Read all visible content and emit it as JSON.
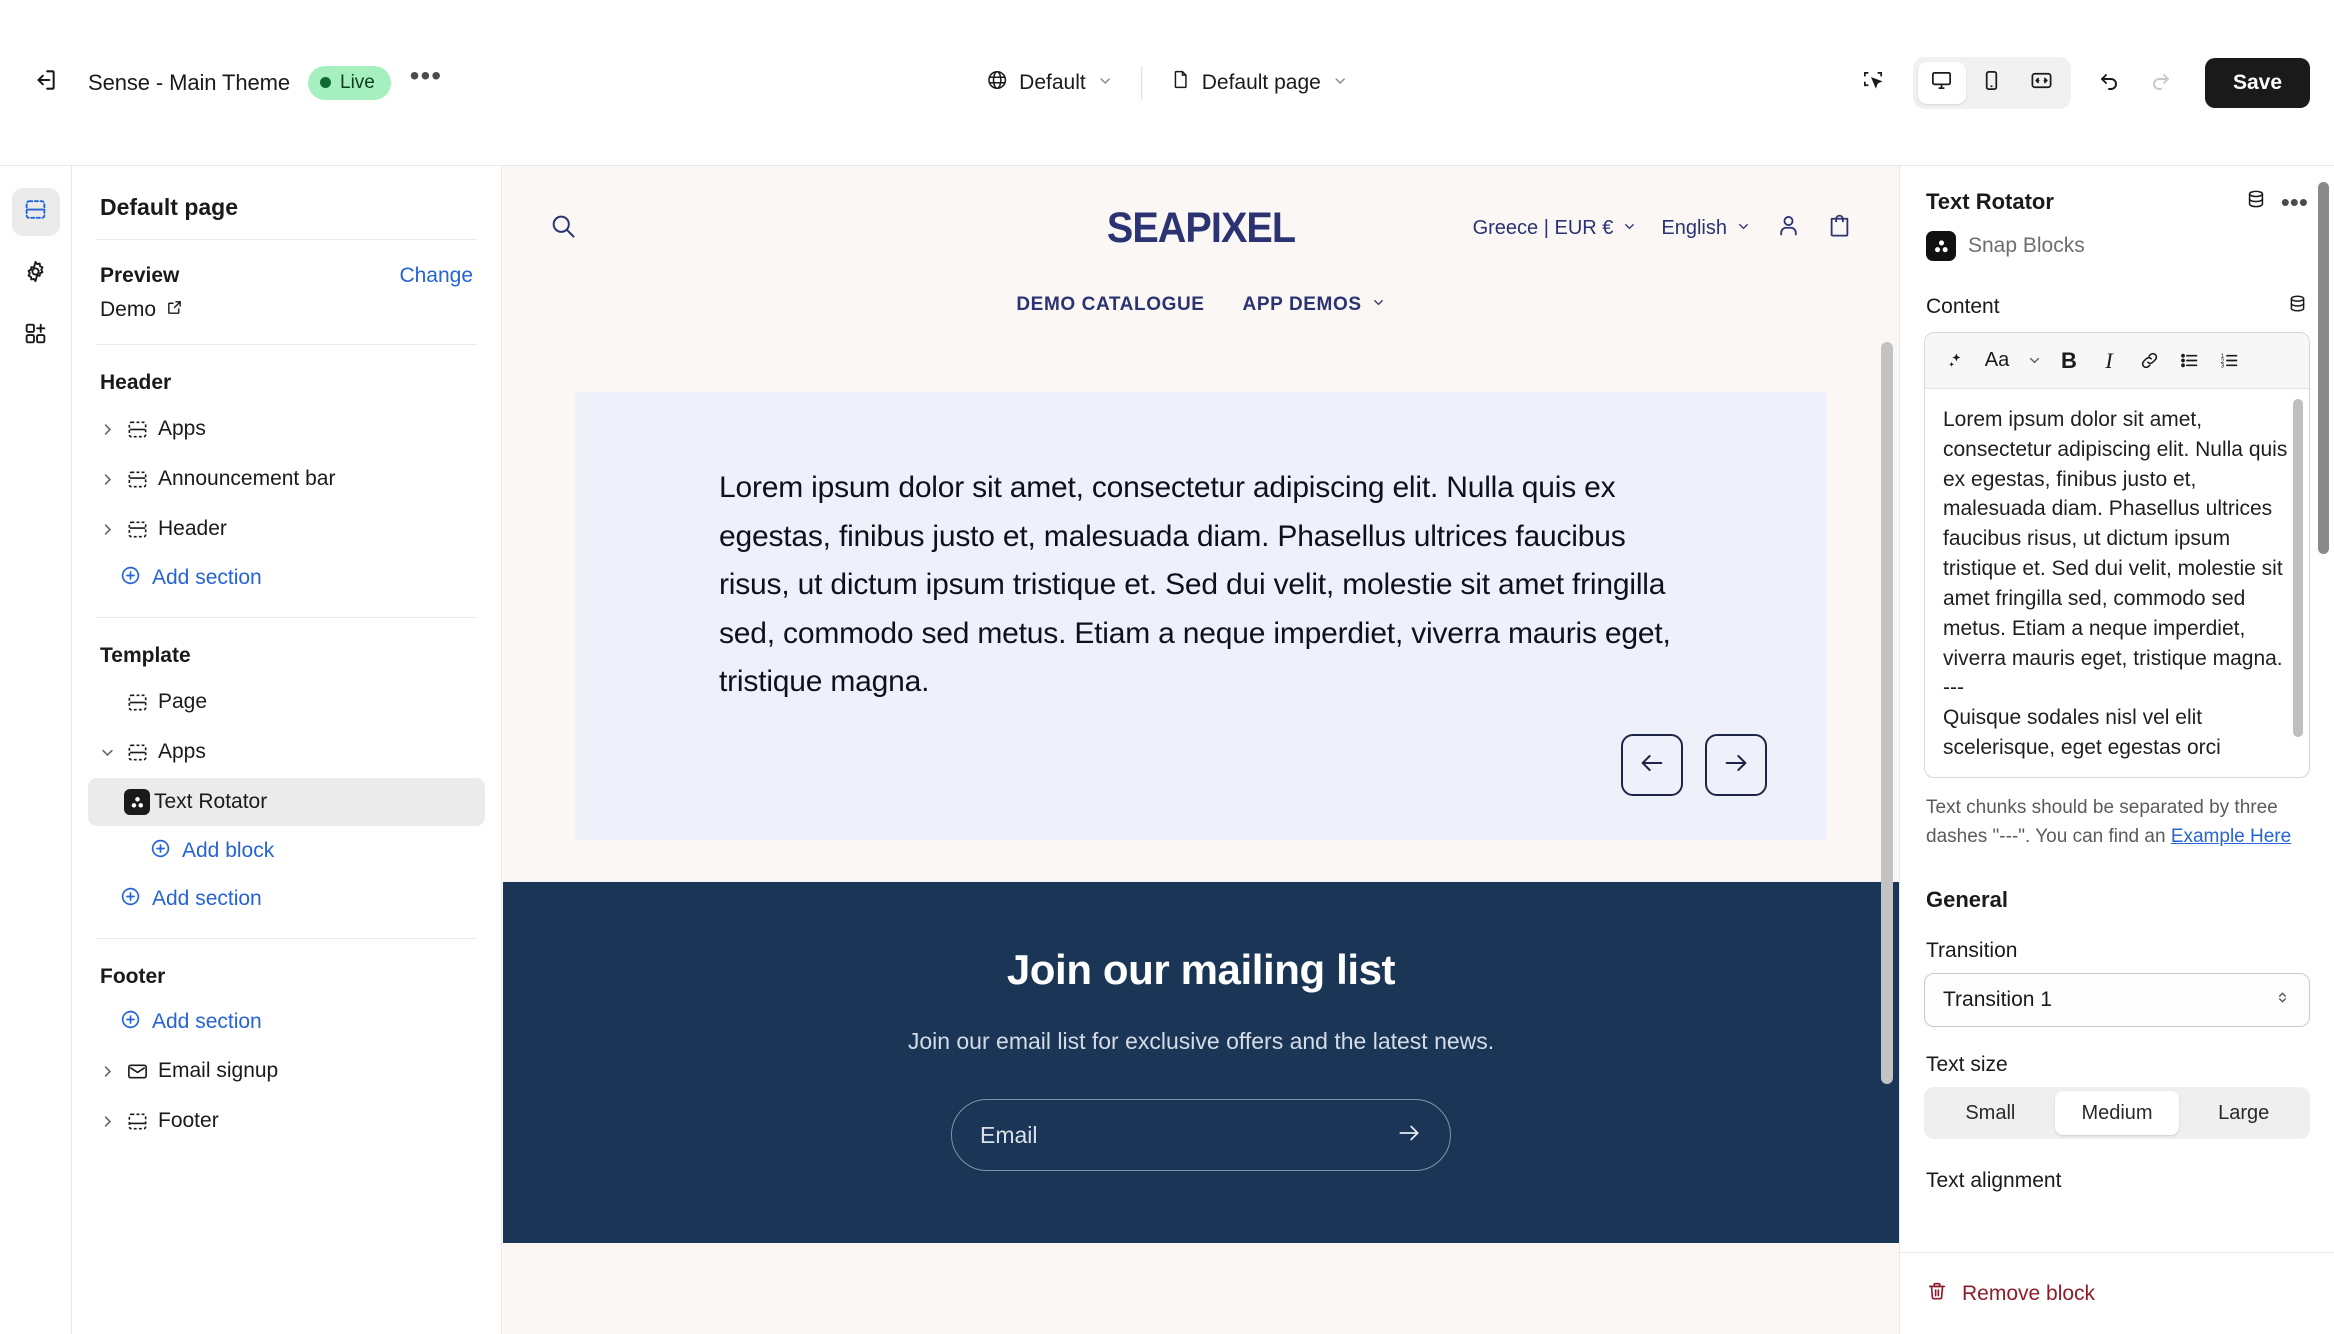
{
  "topbar": {
    "exit_icon": "exit-icon",
    "theme_name": "Sense - Main Theme",
    "status_badge": "Live",
    "more_label": "•••",
    "context": {
      "globe_icon": "globe-icon",
      "market": "Default",
      "page_icon": "page-icon",
      "page": "Default page"
    },
    "tools": {
      "inspect_icon": "inspector-icon",
      "desktop_icon": "desktop-icon",
      "mobile_icon": "mobile-icon",
      "fullwidth_icon": "full-width-icon",
      "undo_icon": "undo-icon",
      "redo_icon": "redo-icon"
    },
    "save_label": "Save"
  },
  "rail": {
    "sections_icon": "sections-icon",
    "settings_icon": "gear-icon",
    "apps_icon": "app-blocks-icon"
  },
  "sidebar": {
    "title": "Default page",
    "preview": {
      "label": "Preview",
      "change_label": "Change",
      "value": "Demo",
      "external_icon": "external-link-icon"
    },
    "groups": [
      {
        "label": "Header",
        "items": [
          {
            "label": "Apps",
            "icon": "app-section-icon",
            "caret": true,
            "expanded": false
          },
          {
            "label": "Announcement bar",
            "icon": "section-icon",
            "caret": true,
            "expanded": false
          },
          {
            "label": "Header",
            "icon": "section-icon",
            "caret": true,
            "expanded": false
          }
        ],
        "add_label": "Add section"
      },
      {
        "label": "Template",
        "items": [
          {
            "label": "Page",
            "icon": "app-section-icon",
            "caret": false,
            "expanded": false
          },
          {
            "label": "Apps",
            "icon": "app-section-icon",
            "caret": true,
            "expanded": true
          }
        ],
        "child": {
          "label": "Text Rotator",
          "icon": "snap-blocks-icon",
          "selected": true
        },
        "add_block_label": "Add block",
        "add_label": "Add section"
      },
      {
        "label": "Footer",
        "add_label": "Add section",
        "items": [
          {
            "label": "Email signup",
            "icon": "envelope-icon",
            "caret": true,
            "expanded": false
          },
          {
            "label": "Footer",
            "icon": "footer-section-icon",
            "caret": true,
            "expanded": false
          }
        ]
      }
    ]
  },
  "preview": {
    "search_icon": "search-icon",
    "logo": "SEAPIXEL",
    "country_currency": "Greece | EUR €",
    "language": "English",
    "account_icon": "account-icon",
    "cart_icon": "cart-icon",
    "nav": [
      {
        "label": "DEMO CATALOGUE",
        "has_caret": false
      },
      {
        "label": "APP DEMOS",
        "has_caret": true
      }
    ],
    "rotator_text": "Lorem ipsum dolor sit amet, consectetur adipiscing elit. Nulla quis ex egestas, finibus justo et, malesuada diam. Phasellus ultrices faucibus risus, ut dictum ipsum tristique et. Sed dui velit, molestie sit amet fringilla sed, commodo sed metus. Etiam a neque imperdiet, viverra mauris eget, tristique magna.",
    "prev_icon": "arrow-left-icon",
    "next_icon": "arrow-right-icon",
    "mailing": {
      "heading": "Join our mailing list",
      "sub": "Join our email list for exclusive offers and the latest news.",
      "email_placeholder": "Email",
      "submit_icon": "arrow-right-icon"
    },
    "colors": {
      "page_bg": "#faf7f5",
      "block_bg": "#eef1fa",
      "brand_navy": "#2b3372",
      "footer_navy": "#1b3557"
    }
  },
  "right_panel": {
    "title": "Text Rotator",
    "db_icon": "database-icon",
    "more_icon": "more-icon",
    "app_name": "Snap Blocks",
    "app_icon": "snap-blocks-icon",
    "content_label": "Content",
    "content_db_icon": "database-icon",
    "toolbar": {
      "ai_icon": "sparkle-icon",
      "font_label": "Aa",
      "font_caret_icon": "chevron-down-icon",
      "bold_label": "B",
      "italic_label": "I",
      "link_icon": "link-icon",
      "bullet_list_icon": "bulleted-list-icon",
      "numbered_list_icon": "numbered-list-icon"
    },
    "content_value": "Lorem ipsum dolor sit amet, consectetur adipiscing elit. Nulla quis ex egestas, finibus justo et, malesuada diam. Phasellus ultrices faucibus risus, ut dictum ipsum tristique et. Sed dui velit, molestie sit amet fringilla sed, commodo sed metus. Etiam a neque imperdiet, viverra mauris eget, tristique magna.\n---\nQuisque sodales nisl vel elit scelerisque, eget egestas orci",
    "help_text": "Text chunks should be separated by three dashes \"---\". You can find an ",
    "help_link": "Example Here",
    "general_label": "General",
    "transition_label": "Transition",
    "transition_value": "Transition 1",
    "text_size_label": "Text size",
    "text_size_options": [
      "Small",
      "Medium",
      "Large"
    ],
    "text_size_selected": "Medium",
    "text_alignment_label": "Text alignment",
    "remove_label": "Remove block",
    "remove_icon": "trash-icon"
  }
}
